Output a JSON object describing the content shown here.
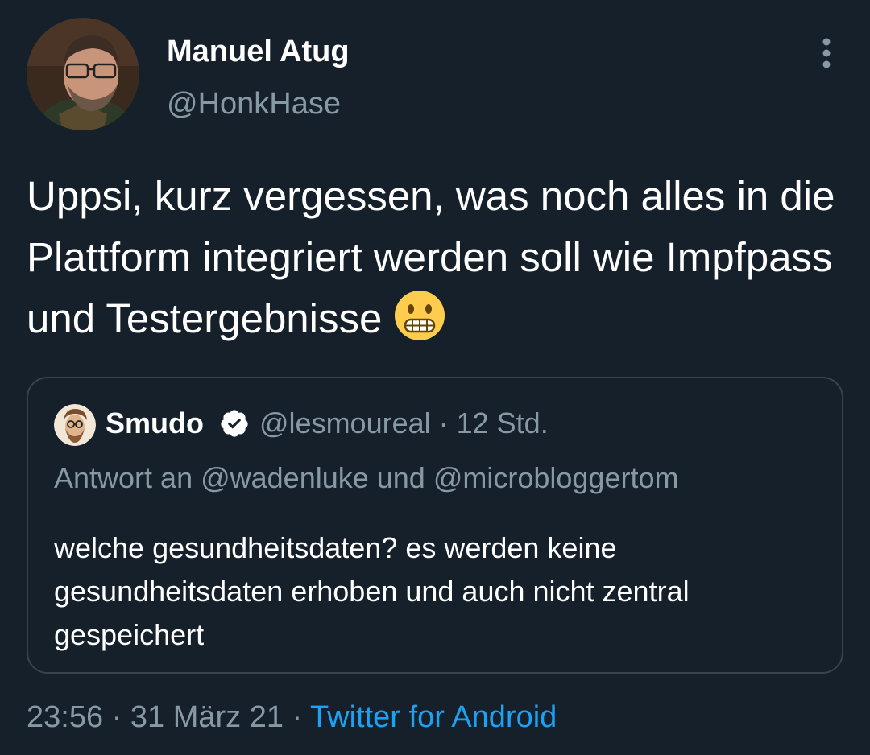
{
  "author": {
    "name": "Manuel Atug",
    "handle": "@HonkHase"
  },
  "tweet": {
    "text": "Uppsi, kurz vergessen, was noch alles in die Plattform integriert werden soll wie Impfpass und Testergebnisse",
    "emoji": "grimacing-face"
  },
  "quote": {
    "name": "Smudo",
    "verified": true,
    "handle_time": "@lesmoureal · 12 Std.",
    "reply_to": "Antwort an @wadenluke und @microbloggertom",
    "text": "welche gesundheitsdaten? es werden keine gesundheitsdaten erhoben und auch nicht zentral gespeichert"
  },
  "meta": {
    "timestamp": "23:56 · 31 März 21 · ",
    "source": "Twitter for Android"
  },
  "colors": {
    "background": "#15202b",
    "secondary_text": "#8899a6",
    "link": "#1da1f2",
    "border": "#38444d"
  }
}
